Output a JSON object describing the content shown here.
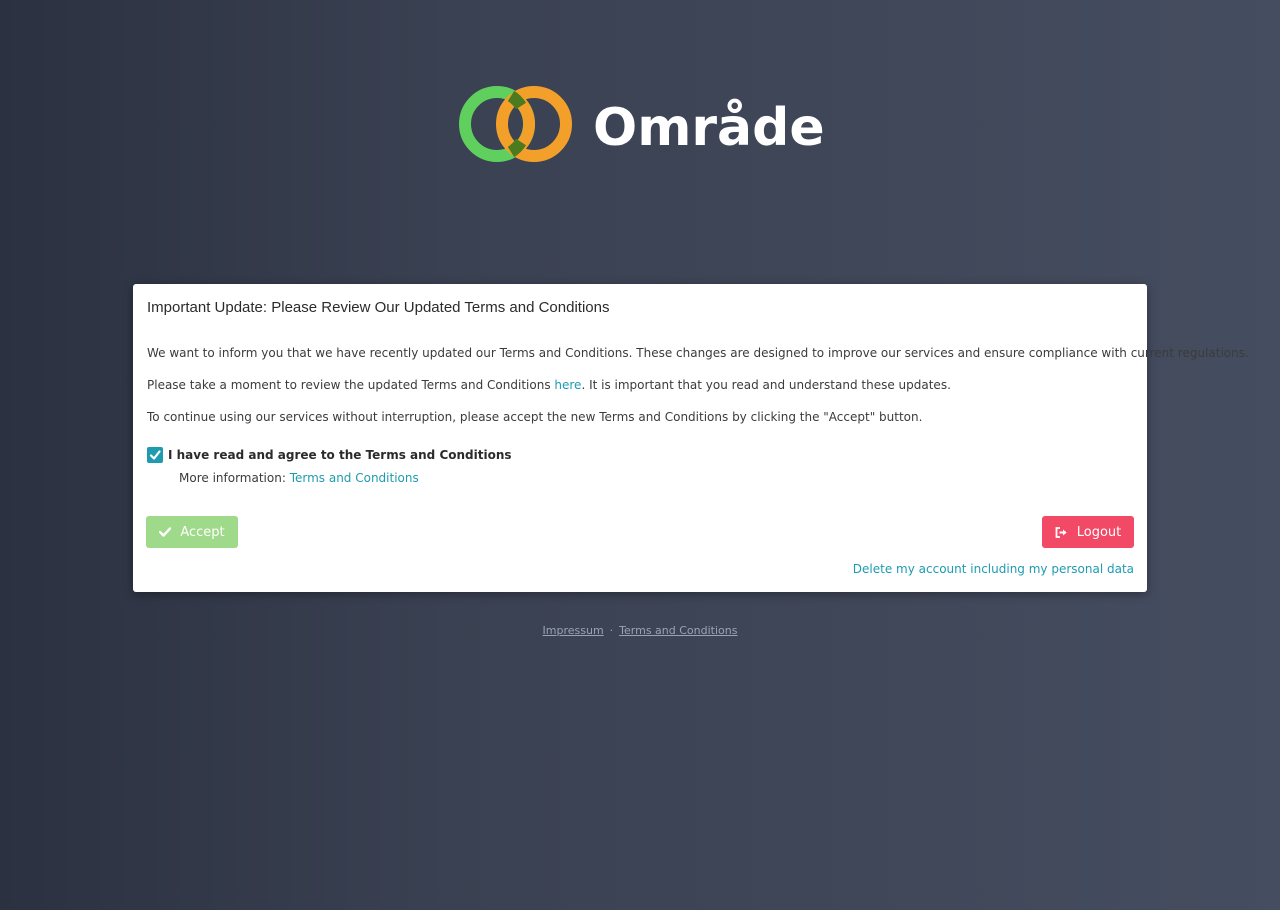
{
  "brand": {
    "name": "Område",
    "colors": {
      "green": "#5fd05d",
      "orange": "#f2a02a",
      "overlap": "#4c7a1f"
    }
  },
  "card": {
    "title": "Important Update: Please Review Our Updated Terms and Conditions",
    "paragraph1": "We want to inform you that we have recently updated our Terms and Conditions. These changes are designed to improve our services and ensure compliance with current regulations.",
    "paragraph2_before": "Please take a moment to review the updated Terms and Conditions ",
    "paragraph2_link": "here",
    "paragraph2_after": ". It is important that you read and understand these updates.",
    "paragraph3": "To continue using our services without interruption, please accept the new Terms and Conditions by clicking the \"Accept\" button.",
    "checkbox_label": "I have read and agree to the Terms and Conditions",
    "checkbox_checked": true,
    "more_info_label": "More information: ",
    "more_info_link": "Terms and Conditions",
    "accept_label": "Accept",
    "logout_label": "Logout",
    "delete_link": "Delete my account including my personal data",
    "accept_icon": "check-icon",
    "logout_icon": "sign-out-icon"
  },
  "footer": {
    "impressum": "Impressum",
    "separator": "·",
    "terms": "Terms and Conditions"
  },
  "colors": {
    "accent": "#1f9bb0",
    "accept_button": "#9fd98a",
    "logout_button": "#f24a66"
  }
}
